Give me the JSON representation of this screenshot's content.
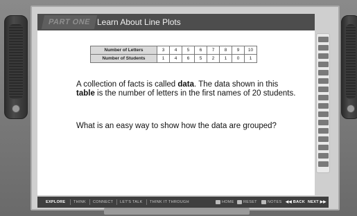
{
  "header": {
    "part": "PART ONE",
    "title": "Learn About Line Plots"
  },
  "table": {
    "row1_label": "Number of Letters",
    "row1": [
      "3",
      "4",
      "5",
      "6",
      "7",
      "8",
      "9",
      "10"
    ],
    "row2_label": "Number of Students",
    "row2": [
      "1",
      "4",
      "6",
      "5",
      "2",
      "1",
      "0",
      "1"
    ]
  },
  "body": {
    "p1_a": "A collection of facts is called ",
    "p1_b": "data",
    "p1_c": ". The data shown in this ",
    "p1_d": "table",
    "p1_e": " is the number of letters in the first names of 20 students.",
    "question": "What is an easy way to show how the data are grouped?"
  },
  "footer": {
    "explore": "EXPLORE",
    "think": "THINK",
    "connect": "CONNECT",
    "lets_talk": "LET'S TALK",
    "think_through": "THINK IT THROUGH",
    "home": "HOME",
    "reset": "RESET",
    "notes": "NOTES",
    "back": "BACK",
    "next": "NEXT"
  }
}
